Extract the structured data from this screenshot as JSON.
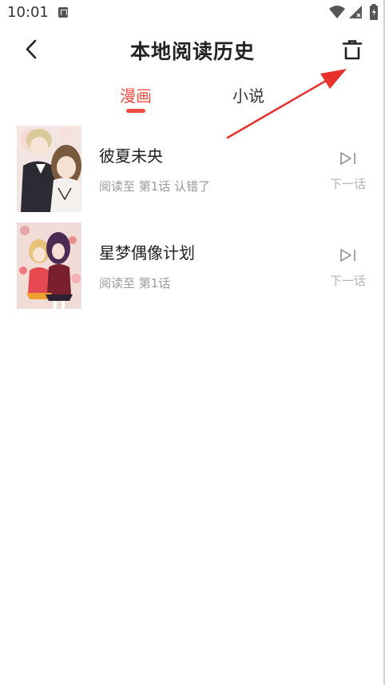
{
  "status_bar": {
    "time": "10:01",
    "icons": [
      "notification-a-icon",
      "wifi-icon",
      "signal-icon",
      "battery-icon"
    ]
  },
  "header": {
    "title": "本地阅读历史",
    "back_icon": "back-chevron-icon",
    "delete_icon": "trash-icon"
  },
  "tabs": [
    {
      "label": "漫画",
      "active": true
    },
    {
      "label": "小说",
      "active": false
    }
  ],
  "history": [
    {
      "title": "彼夏未央",
      "progress": "阅读至 第1话 认错了",
      "next_label": "下一话",
      "cover": "cover-image"
    },
    {
      "title": "星梦偶像计划",
      "progress": "阅读至 第1话",
      "next_label": "下一话",
      "cover": "cover-image"
    }
  ],
  "colors": {
    "accent": "#ef4b42",
    "text_primary": "#222222",
    "text_secondary": "#9a9a9a",
    "text_muted": "#b5b5b5",
    "annotation": "#e8312b"
  }
}
